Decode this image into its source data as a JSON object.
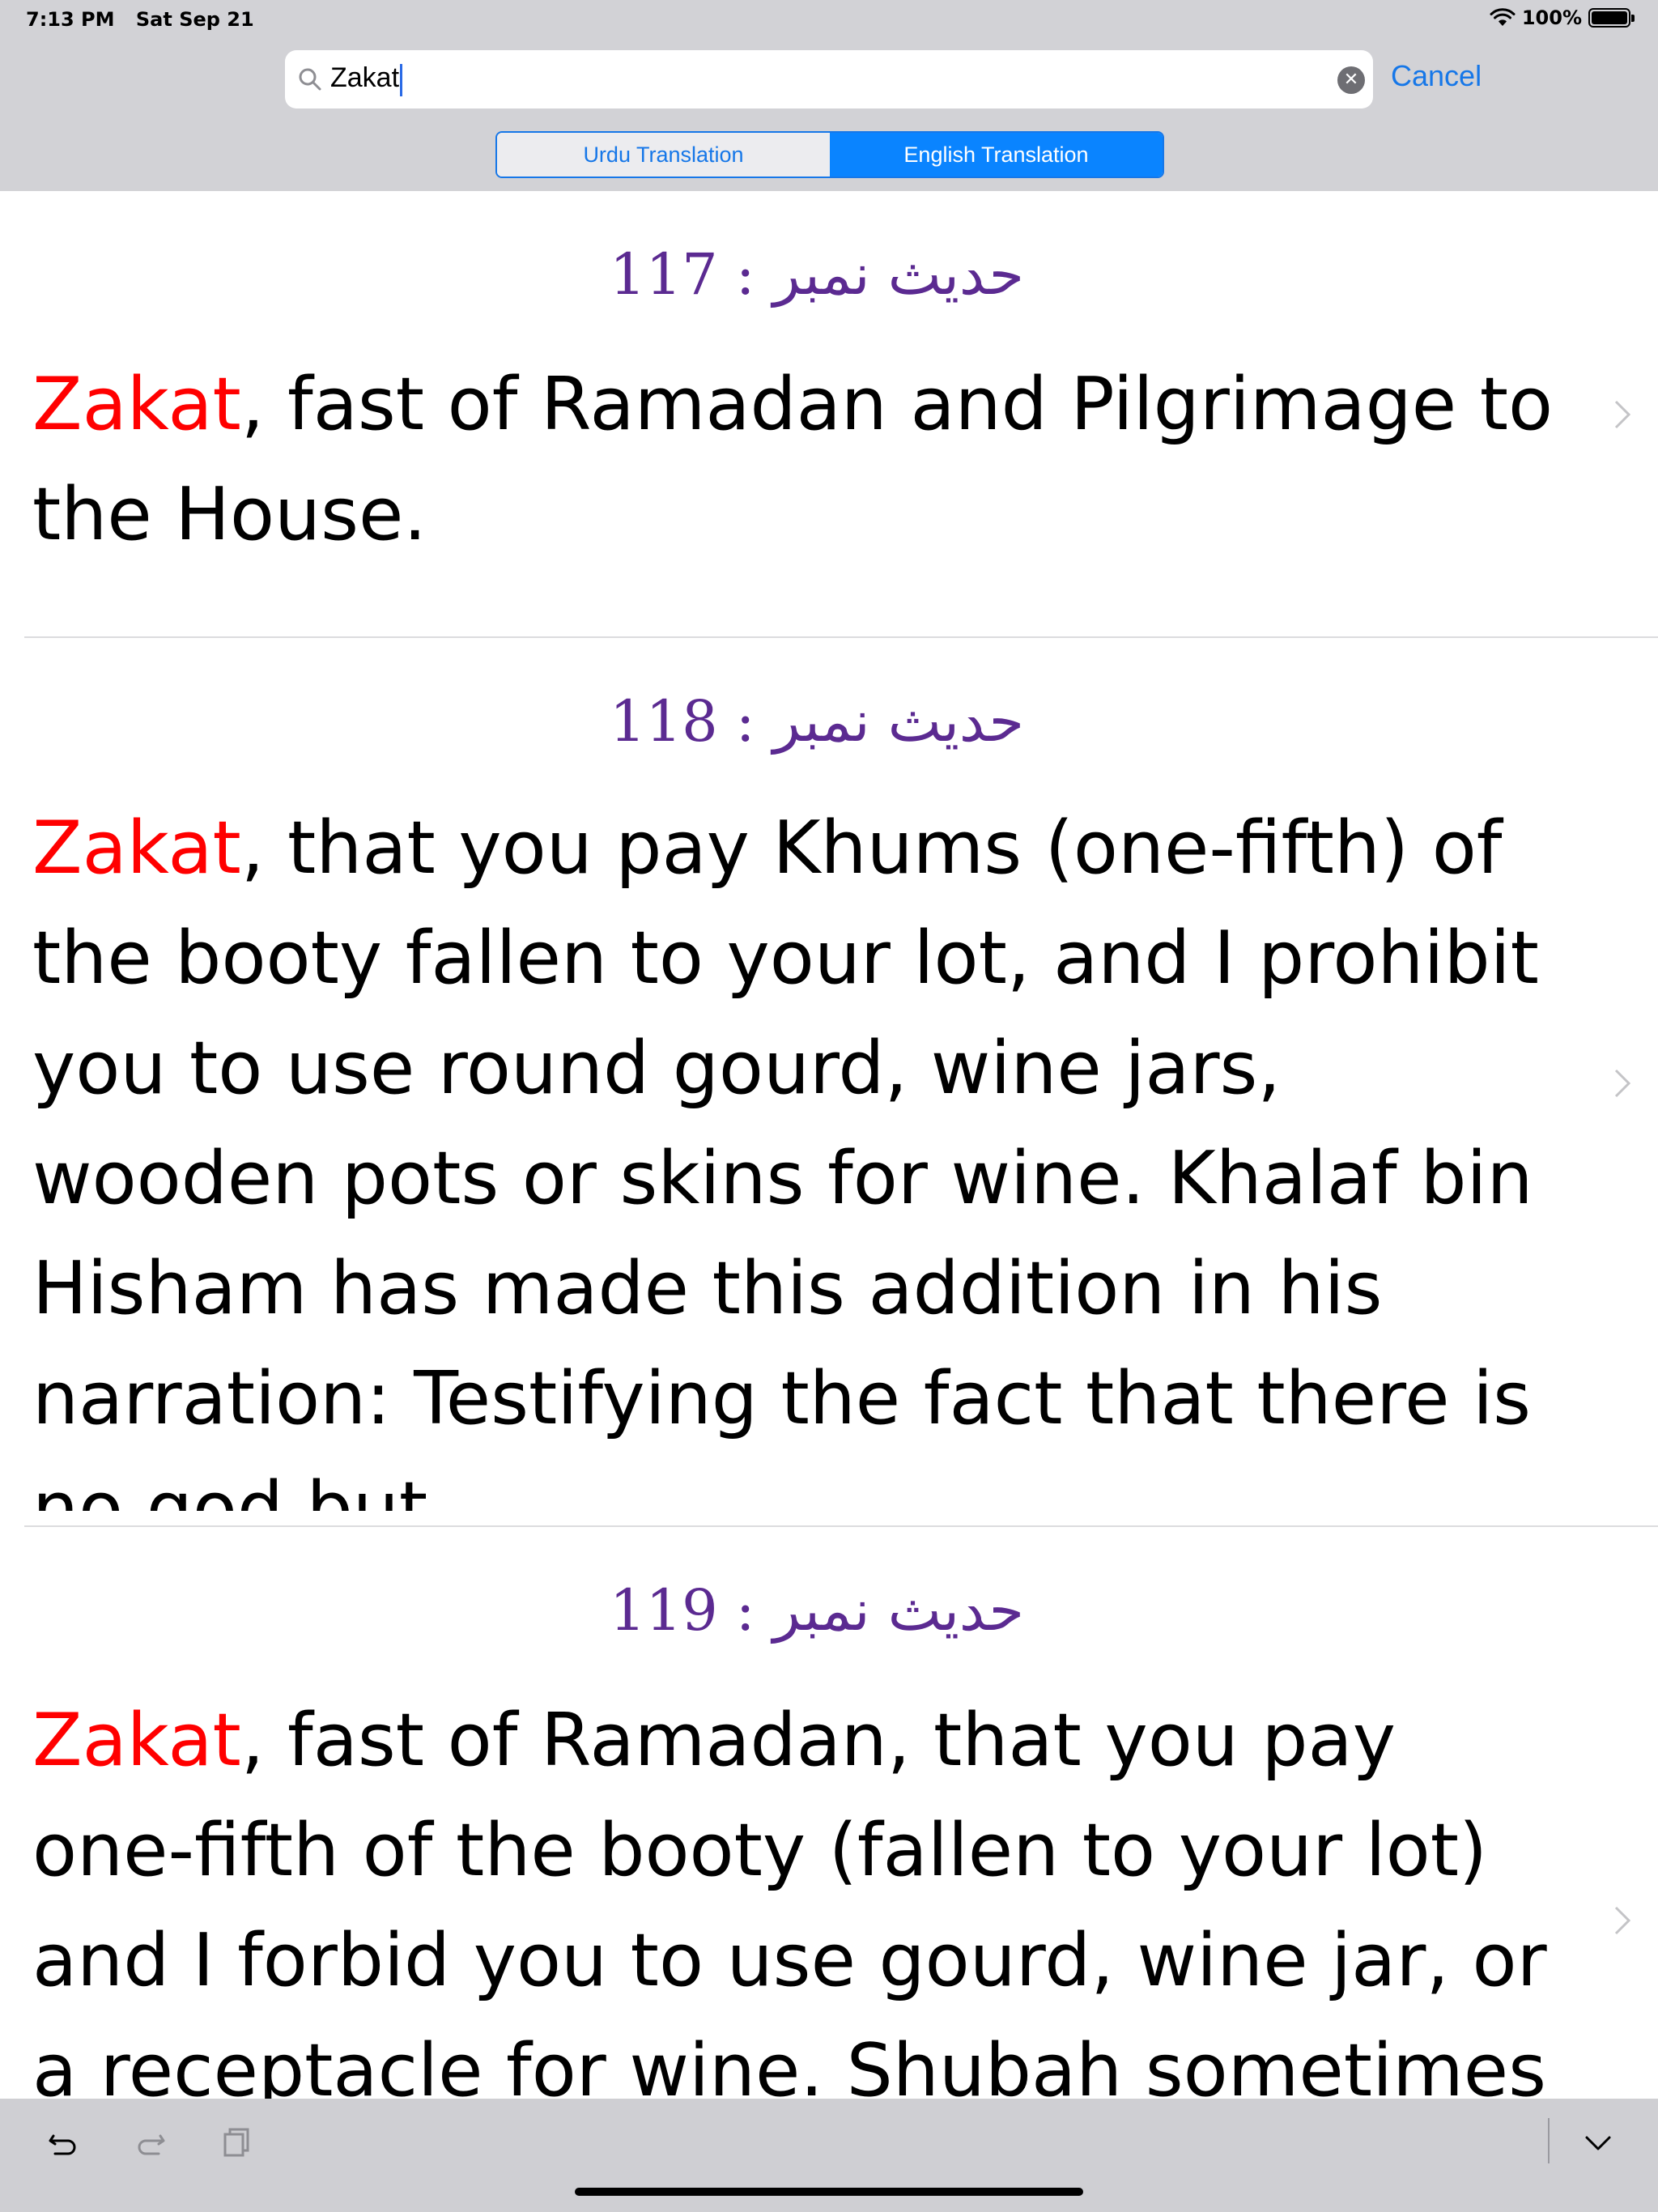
{
  "status_bar": {
    "time": "7:13 PM",
    "date": "Sat Sep 21",
    "battery": "100%"
  },
  "search": {
    "query": "Zakat",
    "cancel_label": "Cancel"
  },
  "segments": {
    "urdu": "Urdu Translation",
    "english": "English Translation",
    "selected": "English Translation"
  },
  "results": [
    {
      "label_urdu": "حدیث نمبر :",
      "number": "117",
      "highlight": "Zakat",
      "rest": ", fast of Ramadan and Pilgrimage to the House."
    },
    {
      "label_urdu": "حدیث نمبر :",
      "number": "118",
      "highlight": "Zakat",
      "rest": ", that you pay Khums (one-fifth) of the booty fallen to your lot, and I prohibit you to use round gourd, wine jars, wooden pots or skins for wine. Khalaf bin Hisham has made this addition in his narration: Testifying the fact that there is no god but"
    },
    {
      "label_urdu": "حدیث نمبر :",
      "number": "119",
      "highlight": "Zakat",
      "rest": ", fast of Ramadan, that you pay one-fifth of the booty (fallen to your lot) and I forbid you to use gourd, wine jar, or a receptacle for wine. Shubah sometimes"
    }
  ],
  "colors": {
    "highlight": "#ff0000",
    "hadith_number": "#5b2a91",
    "accent": "#0a84ff"
  },
  "toolbar": {
    "icons": [
      "undo-icon",
      "redo-icon",
      "paste-icon",
      "keyboard-dismiss-icon"
    ]
  }
}
